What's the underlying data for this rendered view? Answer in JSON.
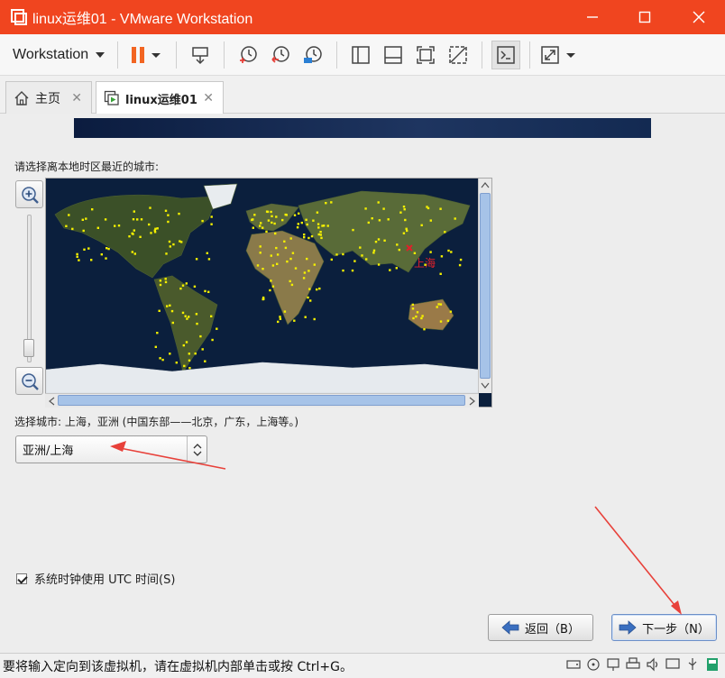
{
  "window": {
    "title": "linux运维01 - VMware Workstation",
    "controls": [
      "minimize",
      "maximize",
      "close"
    ]
  },
  "toolbar": {
    "menu_label": "Workstation",
    "buttons": [
      "pause-icon",
      "send-keys-icon",
      "snapshot-icon",
      "revert-snapshot-icon",
      "snapshot-manager-icon",
      "sidebar-view-icon",
      "console-view-icon",
      "fullscreen-icon",
      "unity-icon",
      "terminal-icon",
      "stretch-icon"
    ]
  },
  "tabs": [
    {
      "label": "主页",
      "icon": "home-icon",
      "active": false
    },
    {
      "label": "linux运维01",
      "icon": "vm-icon",
      "active": true
    }
  ],
  "installer": {
    "prompt": "请选择离本地时区最近的城市:",
    "map_marker_label": "上海",
    "selected_city_text": "选择城市: 上海，亚洲 (中国东部——北京，广东，上海等。)",
    "timezone_value": "亚洲/上海",
    "utc_checkbox_label": "系统时钟使用 UTC 时间(S)",
    "utc_checked": true,
    "back_label": "返回（B）",
    "next_label": "下一步（N）"
  },
  "status": {
    "text": "要将输入定向到该虚拟机，请在虚拟机内部单击或按 Ctrl+G。",
    "icons": [
      "hdd-icon",
      "cdrom-icon",
      "network-icon",
      "printer-icon",
      "sound-icon",
      "display-icon",
      "usb-icon",
      "message-icon"
    ]
  },
  "colors": {
    "titlebar": "#f0451f",
    "annotation_arrow": "#e8413a",
    "map_marker": "#e0202a",
    "city_dot": "#f4f000"
  }
}
